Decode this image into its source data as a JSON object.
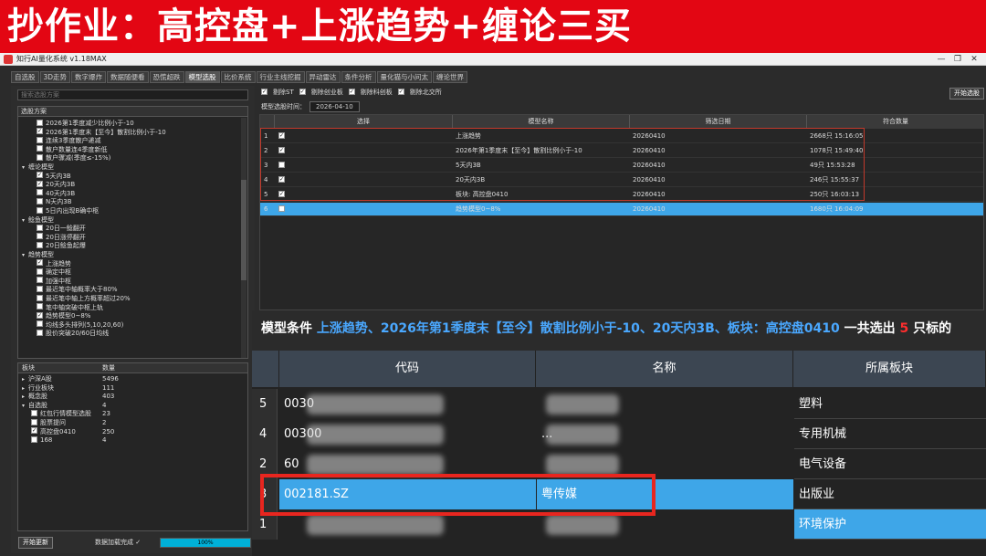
{
  "banner": {
    "title": "抄作业：高控盘+上涨趋势+缠论三买"
  },
  "window": {
    "title": "知行AI量化系统 v1.18MAX",
    "min": "—",
    "max": "❐",
    "close": "✕"
  },
  "tabs": [
    "自选股",
    "3D走势",
    "数字爆炸",
    "数据随便看",
    "恐慌超跌",
    "模型选股",
    "比价系统",
    "行业主线挖掘",
    "异动雷达",
    "条件分析",
    "量化猫与小问太",
    "缠论世界"
  ],
  "left": {
    "search_placeholder": "搜索选股方案",
    "tree_header": "选股方案",
    "tree": [
      {
        "t": "item",
        "label": "2026第1季度减少比例小于-10",
        "checked": false
      },
      {
        "t": "item",
        "label": "2026第1季度末【至今】散割比例小于-10",
        "checked": true
      },
      {
        "t": "item",
        "label": "连续3季度散户递减",
        "checked": false
      },
      {
        "t": "item",
        "label": "散户数量连4季度新低",
        "checked": false
      },
      {
        "t": "item",
        "label": "散户骤减(季度≤-15%)",
        "checked": false
      },
      {
        "t": "group",
        "label": "缠论模型"
      },
      {
        "t": "item",
        "label": "5天内3B",
        "checked": true
      },
      {
        "t": "item",
        "label": "20天内3B",
        "checked": true
      },
      {
        "t": "item",
        "label": "40天内3B",
        "checked": false
      },
      {
        "t": "item",
        "label": "N天内3B",
        "checked": false
      },
      {
        "t": "item",
        "label": "5日内出现B确中枢",
        "checked": false
      },
      {
        "t": "group",
        "label": "鲶鱼模型"
      },
      {
        "t": "item",
        "label": "20日一鲶翻开",
        "checked": false
      },
      {
        "t": "item",
        "label": "20日涨停翻开",
        "checked": false
      },
      {
        "t": "item",
        "label": "20日鲶鱼起爆",
        "checked": false
      },
      {
        "t": "group",
        "label": "趋势模型"
      },
      {
        "t": "item",
        "label": "上涨趋势",
        "checked": true
      },
      {
        "t": "item",
        "label": "确定中枢",
        "checked": false
      },
      {
        "t": "item",
        "label": "加强中枢",
        "checked": false
      },
      {
        "t": "item",
        "label": "最近笔中轴概率大于80%",
        "checked": false
      },
      {
        "t": "item",
        "label": "最近笔中轴上方概率超过20%",
        "checked": false
      },
      {
        "t": "item",
        "label": "笔中轴突破中枢上轨",
        "checked": false
      },
      {
        "t": "item",
        "label": "趋势模型0~8%",
        "checked": true
      },
      {
        "t": "item",
        "label": "均线多头排列(5,10,20,60)",
        "checked": false
      },
      {
        "t": "item",
        "label": "股价突破20/60日均线",
        "checked": false
      }
    ],
    "boards_header": [
      "板块",
      "数量"
    ],
    "boards": [
      {
        "t": "group",
        "label": "沪深A股",
        "count": "5496"
      },
      {
        "t": "group",
        "label": "行业板块",
        "count": "111"
      },
      {
        "t": "group",
        "label": "概念股",
        "count": "403"
      },
      {
        "t": "group",
        "label": "自选股",
        "count": "4"
      },
      {
        "t": "item",
        "label": "红包行情模型选股",
        "count": "23",
        "checked": false
      },
      {
        "t": "item",
        "label": "股票提问",
        "count": "2",
        "checked": false
      },
      {
        "t": "item",
        "label": "高控盘0410",
        "count": "250",
        "checked": true
      },
      {
        "t": "item",
        "label": "168",
        "count": "4",
        "checked": false
      }
    ],
    "open_button": "开始更新",
    "status_text": "数据加载完成 ✓",
    "progress_label": "100%",
    "progress": 1.0
  },
  "right": {
    "filters": [
      {
        "label": "剔除ST",
        "checked": true
      },
      {
        "label": "剔除创业板",
        "checked": true
      },
      {
        "label": "剔除科创板",
        "checked": true
      },
      {
        "label": "剔除北交所",
        "checked": true
      }
    ],
    "date_label": "模型选股时间：",
    "date_value": "2026-04-10",
    "start_button": "开始选股",
    "small_headers": [
      "选择",
      "模型名称",
      "筛选日期",
      "符合数量"
    ],
    "small_rows": [
      {
        "n": "1",
        "checked": true,
        "name": "上涨趋势",
        "date": "20260410",
        "count": "2668只 15:16:05"
      },
      {
        "n": "2",
        "checked": true,
        "name": "2026年第1季度末【至今】散割比例小于-10",
        "date": "20260410",
        "count": "1078只 15:49:40"
      },
      {
        "n": "3",
        "checked": false,
        "name": "5天内3B",
        "date": "20260410",
        "count": "49只 15:53:28"
      },
      {
        "n": "4",
        "checked": true,
        "name": "20天内3B",
        "date": "20260410",
        "count": "246只 15:55:37"
      },
      {
        "n": "5",
        "checked": true,
        "name": "板块: 高控盘0410",
        "date": "20260410",
        "count": "250只 16:03:13"
      },
      {
        "n": "6",
        "checked": false,
        "name": "趋势模型0~8%",
        "date": "20260410",
        "count": "1680只 16:04:09"
      }
    ]
  },
  "overlay": {
    "cond_prefix": "模型条件",
    "cond_items": "上涨趋势、2026年第1季度末【至今】散割比例小于-10、20天内3B、板块：高控盘0410",
    "cond_mid": "一共选出",
    "cond_count": "5",
    "cond_suffix": "只标的",
    "headers": [
      "代码",
      "名称",
      "所属板块"
    ],
    "rows": [
      {
        "n": "5",
        "code": "0030",
        "name": "",
        "sector": "塑料"
      },
      {
        "n": "4",
        "code": "00300",
        "name": "...",
        "sector": "专用机械"
      },
      {
        "n": "2",
        "code": "60",
        "name": "",
        "sector": "电气设备"
      },
      {
        "n": "3",
        "code": "002181.SZ",
        "name": "粤传媒",
        "sector": "出版业"
      },
      {
        "n": "1",
        "code": "",
        "name": "",
        "sector": "环境保护"
      }
    ]
  }
}
